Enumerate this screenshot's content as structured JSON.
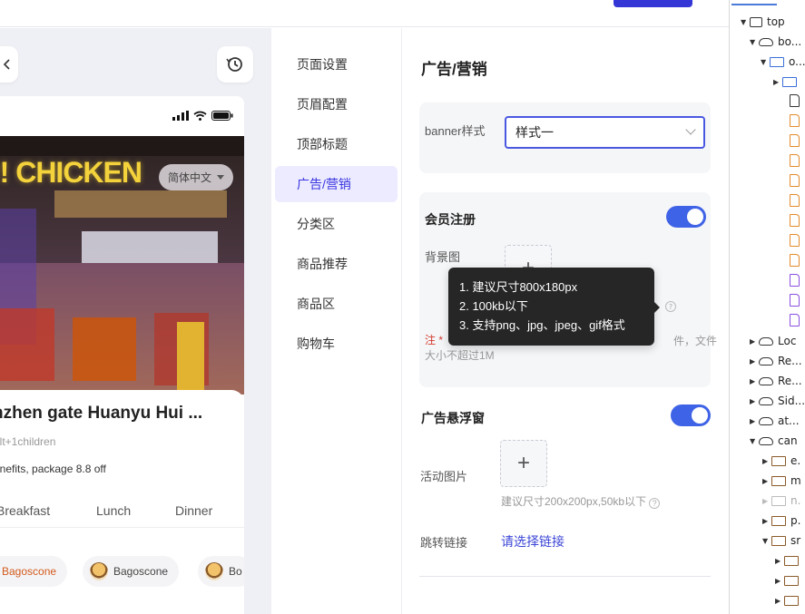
{
  "preview": {
    "lang_pill": "简体中文",
    "store_name": "nzhen gate Huanyu Hui ...",
    "store_sub": "ult+1children",
    "store_benefit": "enefits, package 8.8 off",
    "meal_tabs": [
      "Breakfast",
      "Lunch",
      "Dinner"
    ],
    "chips": [
      "Bagoscone",
      "Bagoscone",
      "Bo"
    ],
    "hero_sign": "!! CHICKEN"
  },
  "menu": {
    "items": [
      "页面设置",
      "页眉配置",
      "顶部标题",
      "广告/营销",
      "分类区",
      "商品推荐",
      "商品区",
      "购物车"
    ],
    "active": "广告/营销"
  },
  "panel": {
    "title": "广告/营销",
    "banner_label": "banner样式",
    "banner_value": "样式一",
    "member": {
      "title": "会员注册",
      "bg_label": "背景图",
      "note_prefix": "注",
      "note_line1_tail": "件，文件",
      "note_line2": "大小不超过1M",
      "enabled": true
    },
    "float": {
      "title": "广告悬浮窗",
      "image_label": "活动图片",
      "image_hint": "建议尺寸200x200px,50kb以下",
      "link_label": "跳转链接",
      "link_value": "请选择链接",
      "enabled": true
    }
  },
  "tooltip": {
    "lines": [
      "1. 建议尺寸800x180px",
      "2. 100kb以下",
      "3. 支持png、jpg、jpeg、gif格式"
    ]
  },
  "tree": {
    "rows": [
      {
        "label": "top",
        "icon": "window-icon"
      },
      {
        "label": "bo...",
        "icon": "cloud-icon"
      },
      {
        "label": "o...",
        "icon": "folder-icon"
      },
      {
        "label": "",
        "icon": "folder-icon"
      },
      {
        "label": "",
        "icon": "file-icon"
      },
      {
        "label": "Loc",
        "icon": "cloud-icon"
      },
      {
        "label": "Re...",
        "icon": "cloud-icon"
      },
      {
        "label": "Re...",
        "icon": "cloud-icon"
      },
      {
        "label": "Sid...",
        "icon": "cloud-icon"
      },
      {
        "label": "at...",
        "icon": "cloud-icon"
      },
      {
        "label": "can",
        "icon": "cloud-icon"
      },
      {
        "label": "e.",
        "icon": "folder-icon"
      },
      {
        "label": "m",
        "icon": "folder-icon"
      },
      {
        "label": "n.",
        "icon": "folder-icon"
      },
      {
        "label": "p.",
        "icon": "folder-icon"
      },
      {
        "label": "sr",
        "icon": "folder-icon"
      }
    ]
  },
  "colors": {
    "accent": "#3a36e0",
    "toggle_on": "#3f63e6",
    "link": "#3c46d6",
    "note_red": "#d23b2e"
  }
}
